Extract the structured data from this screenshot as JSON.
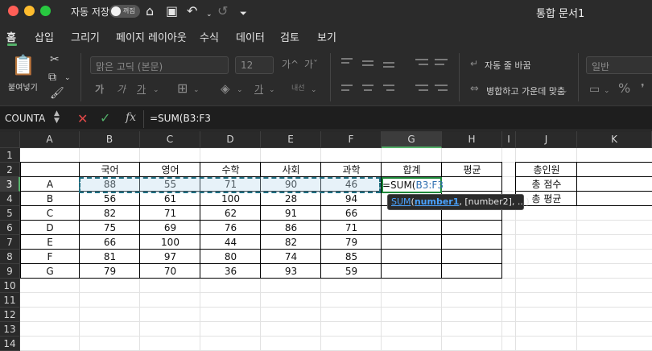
{
  "titlebar": {
    "autosave_label": "자동 저장",
    "toggle_label": "꺼짐",
    "doc_title": "통합 문서1"
  },
  "tabs": [
    "홈",
    "삽입",
    "그리기",
    "페이지 레이아웃",
    "수식",
    "데이터",
    "검토",
    "보기"
  ],
  "ribbon": {
    "paste_label": "붙여넣기",
    "font_name": "맑은 고딕 (본문)",
    "font_size": "12",
    "wrap_text_label": "자동 줄 바꿈",
    "merge_center_label": "병합하고 가운데 맞춤",
    "number_format": "일반",
    "orientation_label": "내선",
    "bold_glyph": "가",
    "italic_glyph": "가",
    "underline_glyph": "가",
    "font_color_glyph": "가",
    "grow_glyph": "가^",
    "shrink_glyph": "가ˇ",
    "percent_glyph": "%"
  },
  "formula_bar": {
    "name_box": "COUNTA",
    "formula": "=SUM(B3:F3"
  },
  "columns": [
    "A",
    "B",
    "C",
    "D",
    "E",
    "F",
    "G",
    "H",
    "I",
    "J",
    "K"
  ],
  "selected_column": "G",
  "rows": [
    "1",
    "2",
    "3",
    "4",
    "5",
    "6",
    "7",
    "8",
    "9",
    "10",
    "11",
    "12",
    "13",
    "14"
  ],
  "selected_row": "3",
  "headers": {
    "B": "국어",
    "C": "영어",
    "D": "수학",
    "E": "사회",
    "F": "과학",
    "G": "합계",
    "H": "평균"
  },
  "table": [
    {
      "name": "A",
      "scores": [
        "88",
        "55",
        "71",
        "90",
        "46"
      ]
    },
    {
      "name": "B",
      "scores": [
        "56",
        "61",
        "100",
        "28",
        "94"
      ]
    },
    {
      "name": "C",
      "scores": [
        "82",
        "71",
        "62",
        "91",
        "66"
      ]
    },
    {
      "name": "D",
      "scores": [
        "75",
        "69",
        "76",
        "86",
        "71"
      ]
    },
    {
      "name": "E",
      "scores": [
        "66",
        "100",
        "44",
        "82",
        "79"
      ]
    },
    {
      "name": "F",
      "scores": [
        "81",
        "97",
        "80",
        "74",
        "85"
      ]
    },
    {
      "name": "G",
      "scores": [
        "79",
        "70",
        "36",
        "93",
        "59"
      ]
    }
  ],
  "summary": {
    "title": "총인원",
    "total_score": "총 점수",
    "total_avg": "총 평균"
  },
  "edit_cell": {
    "prefix": "=SUM(",
    "ref": "B3:F3"
  },
  "tooltip": {
    "fn": "SUM",
    "open": "(",
    "arg1": "number1",
    "rest": ", [number2], ...)"
  },
  "colors": {
    "accent": "#55b06a",
    "cancel": "#e04848",
    "marquee": "#1f6f82",
    "reference": "#2f6fb0"
  }
}
